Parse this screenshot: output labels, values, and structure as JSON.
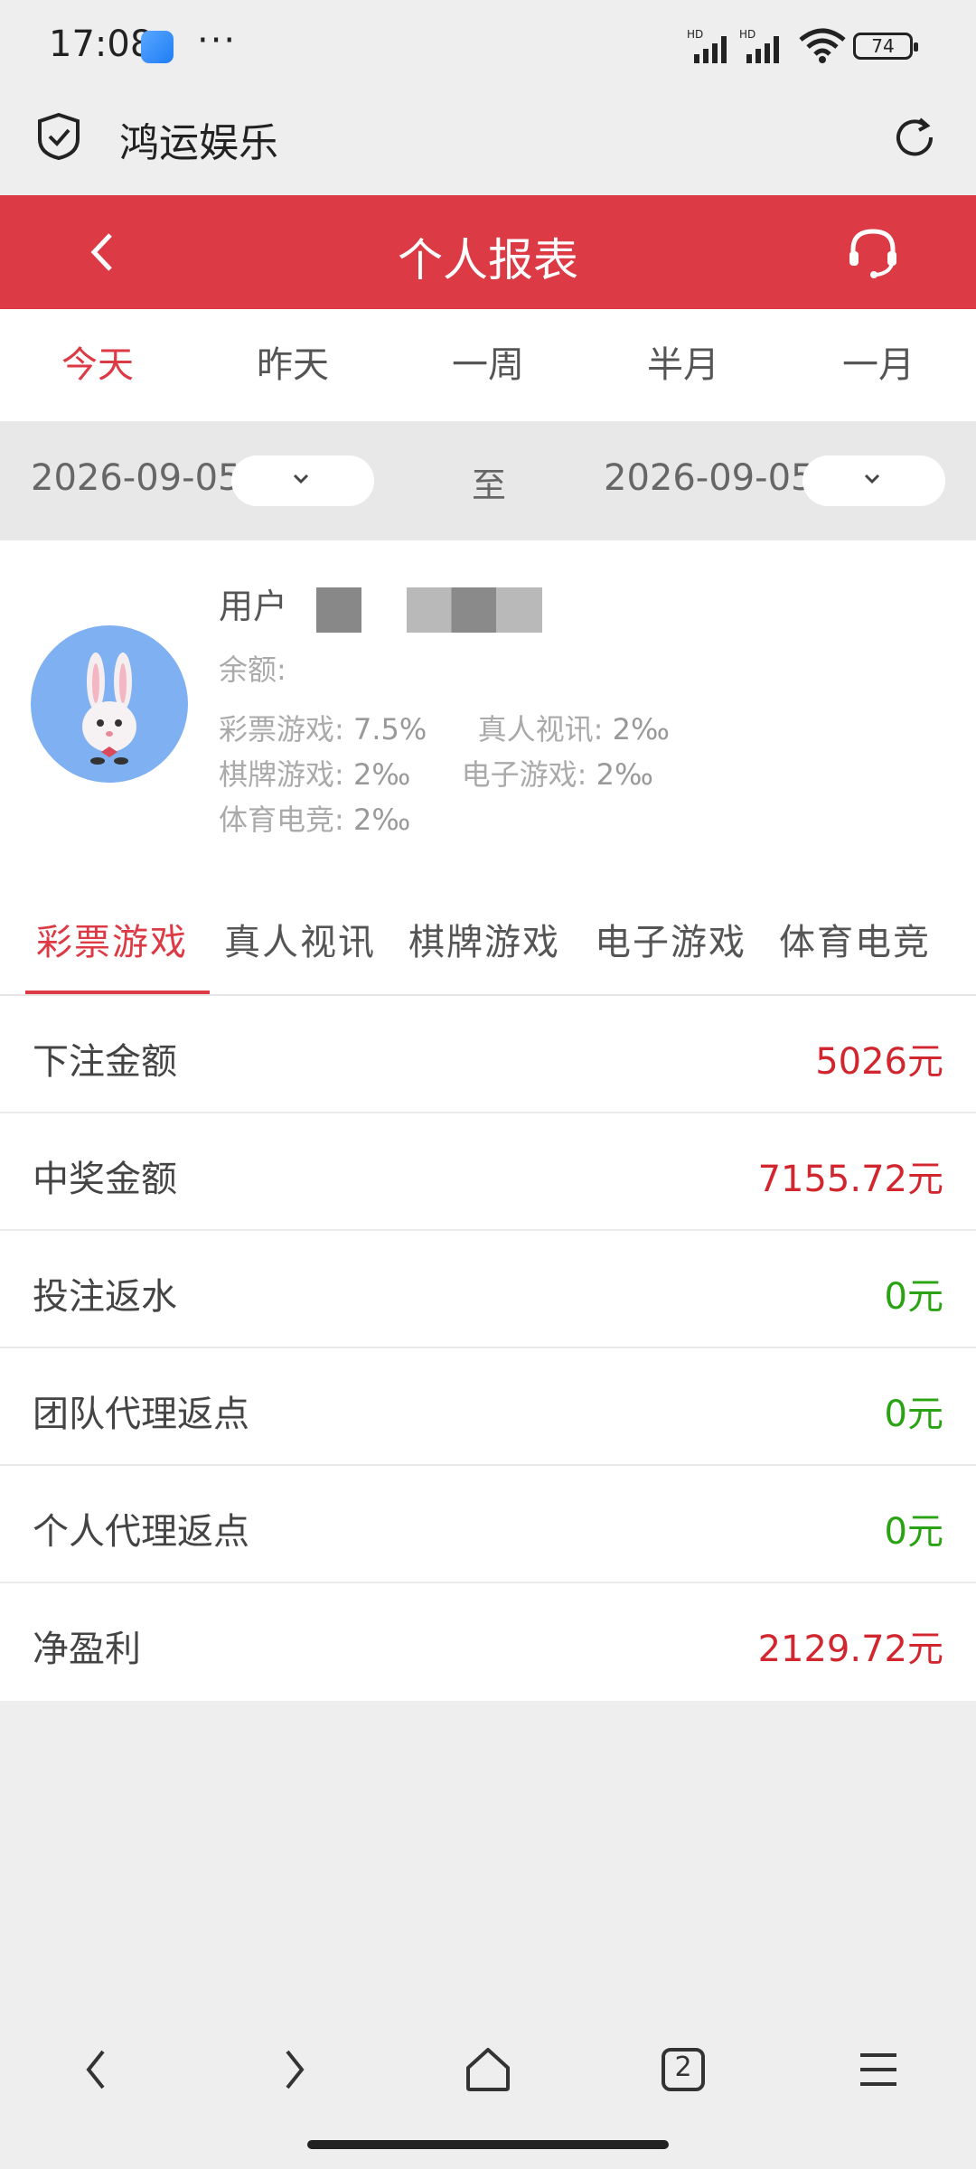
{
  "status": {
    "time": "17:08",
    "dots": "···",
    "battery": "74"
  },
  "browser": {
    "site": "鸿运娱乐"
  },
  "header": {
    "title": "个人报表"
  },
  "period_tabs": [
    "今天",
    "昨天",
    "一周",
    "半月",
    "一月"
  ],
  "dates": {
    "start": "2026-09-05",
    "to": "至",
    "end": "2026-09-05"
  },
  "user": {
    "name_label": "用户",
    "balance_label": "余额:",
    "rates": [
      {
        "label": "彩票游戏:",
        "value": "7.5%"
      },
      {
        "label": "真人视讯:",
        "value": "2‰"
      },
      {
        "label": "棋牌游戏:",
        "value": "2‰"
      },
      {
        "label": "电子游戏:",
        "value": "2‰"
      },
      {
        "label": "体育电竞:",
        "value": "2‰"
      }
    ]
  },
  "game_tabs": [
    "彩票游戏",
    "真人视讯",
    "棋牌游戏",
    "电子游戏",
    "体育电竞"
  ],
  "report": [
    {
      "label": "下注金额",
      "value": "5026元",
      "color": "#d2262f"
    },
    {
      "label": "中奖金额",
      "value": "7155.72元",
      "color": "#d2262f"
    },
    {
      "label": "投注返水",
      "value": "0元",
      "color": "#2aa313"
    },
    {
      "label": "团队代理返点",
      "value": "0元",
      "color": "#2aa313"
    },
    {
      "label": "个人代理返点",
      "value": "0元",
      "color": "#2aa313"
    },
    {
      "label": "净盈利",
      "value": "2129.72元",
      "color": "#d2262f"
    }
  ],
  "nav": {
    "tabs_count": "2"
  },
  "colors": {
    "accent": "#dc3a45",
    "positive": "#d2262f",
    "zero": "#2aa313"
  }
}
